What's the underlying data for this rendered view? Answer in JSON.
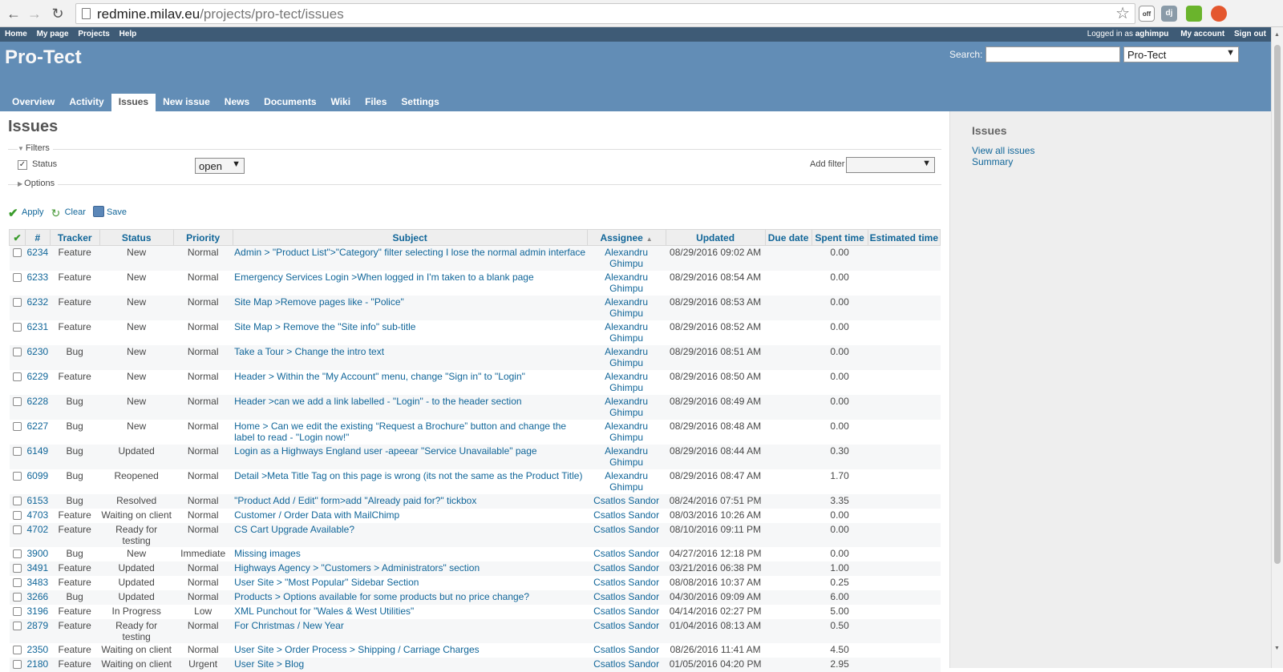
{
  "browser": {
    "url_host": "redmine.milav.eu",
    "url_path": "/projects/pro-tect/issues",
    "ext_dj": "dj",
    "ext_off": "off"
  },
  "top_menu": {
    "items": [
      "Home",
      "My page",
      "Projects",
      "Help"
    ],
    "logged_prefix": "Logged in as",
    "user": "aghimpu",
    "my_account": "My account",
    "sign_out": "Sign out"
  },
  "header": {
    "project_title": "Pro-Tect",
    "search_label": "Search:",
    "search_value": "",
    "project_select": "Pro-Tect"
  },
  "main_menu": {
    "tabs": [
      {
        "label": "Overview",
        "name": "tab-overview"
      },
      {
        "label": "Activity",
        "name": "tab-activity"
      },
      {
        "label": "Issues",
        "name": "tab-issues",
        "selected": true
      },
      {
        "label": "New issue",
        "name": "tab-new-issue"
      },
      {
        "label": "News",
        "name": "tab-news"
      },
      {
        "label": "Documents",
        "name": "tab-documents"
      },
      {
        "label": "Wiki",
        "name": "tab-wiki"
      },
      {
        "label": "Files",
        "name": "tab-files"
      },
      {
        "label": "Settings",
        "name": "tab-settings"
      }
    ]
  },
  "page": {
    "title": "Issues",
    "filters_legend": "Filters",
    "status_label": "Status",
    "status_operator": "open",
    "add_filter_label": "Add filter",
    "options_legend": "Options",
    "apply": "Apply",
    "clear": "Clear",
    "save": "Save"
  },
  "table": {
    "columns": [
      "#",
      "Tracker",
      "Status",
      "Priority",
      "Subject",
      "Assignee",
      "Updated",
      "Due date",
      "Spent time",
      "Estimated time"
    ],
    "rows": [
      {
        "id": "6234",
        "tracker": "Feature",
        "status": "New",
        "priority": "Normal",
        "subject": "Admin > \"Product List\">\"Category\" filter selecting I lose the normal admin interface",
        "assignee": "Alexandru Ghimpu",
        "updated": "08/29/2016 09:02 AM",
        "due": "",
        "spent": "0.00",
        "estimated": ""
      },
      {
        "id": "6233",
        "tracker": "Feature",
        "status": "New",
        "priority": "Normal",
        "subject": "Emergency Services Login >When logged in I'm taken to a blank page",
        "assignee": "Alexandru Ghimpu",
        "updated": "08/29/2016 08:54 AM",
        "due": "",
        "spent": "0.00",
        "estimated": ""
      },
      {
        "id": "6232",
        "tracker": "Feature",
        "status": "New",
        "priority": "Normal",
        "subject": "Site Map >Remove pages like - \"Police\"",
        "assignee": "Alexandru Ghimpu",
        "updated": "08/29/2016 08:53 AM",
        "due": "",
        "spent": "0.00",
        "estimated": ""
      },
      {
        "id": "6231",
        "tracker": "Feature",
        "status": "New",
        "priority": "Normal",
        "subject": "Site Map > Remove the \"Site info\" sub-title",
        "assignee": "Alexandru Ghimpu",
        "updated": "08/29/2016 08:52 AM",
        "due": "",
        "spent": "0.00",
        "estimated": ""
      },
      {
        "id": "6230",
        "tracker": "Bug",
        "status": "New",
        "priority": "Normal",
        "subject": "Take a Tour > Change the intro text",
        "assignee": "Alexandru Ghimpu",
        "updated": "08/29/2016 08:51 AM",
        "due": "",
        "spent": "0.00",
        "estimated": ""
      },
      {
        "id": "6229",
        "tracker": "Feature",
        "status": "New",
        "priority": "Normal",
        "subject": "Header > Within the \"My Account\" menu, change \"Sign in\" to \"Login\"",
        "assignee": "Alexandru Ghimpu",
        "updated": "08/29/2016 08:50 AM",
        "due": "",
        "spent": "0.00",
        "estimated": ""
      },
      {
        "id": "6228",
        "tracker": "Bug",
        "status": "New",
        "priority": "Normal",
        "subject": "Header >can we add a link labelled - \"Login\" - to the header section",
        "assignee": "Alexandru Ghimpu",
        "updated": "08/29/2016 08:49 AM",
        "due": "",
        "spent": "0.00",
        "estimated": ""
      },
      {
        "id": "6227",
        "tracker": "Bug",
        "status": "New",
        "priority": "Normal",
        "subject": "Home > Can we edit the existing “Request a Brochure” button and change the label to read - \"Login now!\"",
        "assignee": "Alexandru Ghimpu",
        "updated": "08/29/2016 08:48 AM",
        "due": "",
        "spent": "0.00",
        "estimated": ""
      },
      {
        "id": "6149",
        "tracker": "Bug",
        "status": "Updated",
        "priority": "Normal",
        "subject": "Login as a Highways England user -apeear \"Service Unavailable\" page",
        "assignee": "Alexandru Ghimpu",
        "updated": "08/29/2016 08:44 AM",
        "due": "",
        "spent": "0.30",
        "estimated": ""
      },
      {
        "id": "6099",
        "tracker": "Bug",
        "status": "Reopened",
        "priority": "Normal",
        "subject": "Detail >Meta Title Tag on this page is wrong (its not the same as the Product Title)",
        "assignee": "Alexandru Ghimpu",
        "updated": "08/29/2016 08:47 AM",
        "due": "",
        "spent": "1.70",
        "estimated": ""
      },
      {
        "id": "6153",
        "tracker": "Bug",
        "status": "Resolved",
        "priority": "Normal",
        "subject": "\"Product Add / Edit\" form>add \"Already paid for?\" tickbox",
        "assignee": "Csatlos Sandor",
        "updated": "08/24/2016 07:51 PM",
        "due": "",
        "spent": "3.35",
        "estimated": ""
      },
      {
        "id": "4703",
        "tracker": "Feature",
        "status": "Waiting on client",
        "priority": "Normal",
        "subject": "Customer / Order Data with MailChimp",
        "assignee": "Csatlos Sandor",
        "updated": "08/03/2016 10:26 AM",
        "due": "",
        "spent": "0.00",
        "estimated": ""
      },
      {
        "id": "4702",
        "tracker": "Feature",
        "status": "Ready for testing",
        "priority": "Normal",
        "subject": "CS Cart Upgrade Available?",
        "assignee": "Csatlos Sandor",
        "updated": "08/10/2016 09:11 PM",
        "due": "",
        "spent": "0.00",
        "estimated": ""
      },
      {
        "id": "3900",
        "tracker": "Bug",
        "status": "New",
        "priority": "Immediate",
        "subject": "Missing images",
        "assignee": "Csatlos Sandor",
        "updated": "04/27/2016 12:18 PM",
        "due": "",
        "spent": "0.00",
        "estimated": ""
      },
      {
        "id": "3491",
        "tracker": "Feature",
        "status": "Updated",
        "priority": "Normal",
        "subject": "Highways Agency > \"Customers > Administrators\" section",
        "assignee": "Csatlos Sandor",
        "updated": "03/21/2016 06:38 PM",
        "due": "",
        "spent": "1.00",
        "estimated": ""
      },
      {
        "id": "3483",
        "tracker": "Feature",
        "status": "Updated",
        "priority": "Normal",
        "subject": "User Site > \"Most Popular\" Sidebar Section",
        "assignee": "Csatlos Sandor",
        "updated": "08/08/2016 10:37 AM",
        "due": "",
        "spent": "0.25",
        "estimated": ""
      },
      {
        "id": "3266",
        "tracker": "Bug",
        "status": "Updated",
        "priority": "Normal",
        "subject": "Products > Options available for some products but no price change?",
        "assignee": "Csatlos Sandor",
        "updated": "04/30/2016 09:09 AM",
        "due": "",
        "spent": "6.00",
        "estimated": ""
      },
      {
        "id": "3196",
        "tracker": "Feature",
        "status": "In Progress",
        "priority": "Low",
        "subject": "XML Punchout for \"Wales & West Utilities\"",
        "assignee": "Csatlos Sandor",
        "updated": "04/14/2016 02:27 PM",
        "due": "",
        "spent": "5.00",
        "estimated": ""
      },
      {
        "id": "2879",
        "tracker": "Feature",
        "status": "Ready for testing",
        "priority": "Normal",
        "subject": "For Christmas / New Year",
        "assignee": "Csatlos Sandor",
        "updated": "01/04/2016 08:13 AM",
        "due": "",
        "spent": "0.50",
        "estimated": ""
      },
      {
        "id": "2350",
        "tracker": "Feature",
        "status": "Waiting on client",
        "priority": "Normal",
        "subject": "User Site > Order Process > Shipping / Carriage Charges",
        "assignee": "Csatlos Sandor",
        "updated": "08/26/2016 11:41 AM",
        "due": "",
        "spent": "4.50",
        "estimated": ""
      },
      {
        "id": "2180",
        "tracker": "Feature",
        "status": "Waiting on client",
        "priority": "Urgent",
        "subject": "User Site > Blog",
        "assignee": "Csatlos Sandor",
        "updated": "01/05/2016 04:20 PM",
        "due": "",
        "spent": "2.95",
        "estimated": ""
      }
    ]
  },
  "sidebar": {
    "title": "Issues",
    "view_all": "View all issues",
    "summary": "Summary"
  }
}
